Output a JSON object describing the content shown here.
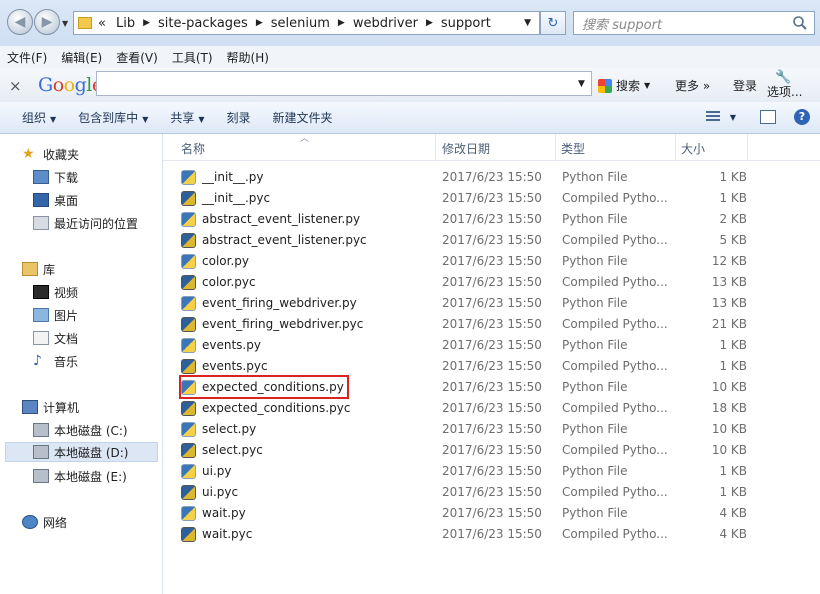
{
  "address": {
    "crumbs": [
      "Lib",
      "site-packages",
      "selenium",
      "webdriver",
      "support"
    ],
    "overflow": "«",
    "search_placeholder": "搜索 support"
  },
  "menu": [
    "文件(F)",
    "编辑(E)",
    "查看(V)",
    "工具(T)",
    "帮助(H)"
  ],
  "google_toolbar": {
    "close": "×",
    "logo": [
      "G",
      "o",
      "o",
      "g",
      "l",
      "e"
    ],
    "logo_colors": [
      "#3a6fd8",
      "#d93c2e",
      "#f0b400",
      "#3a6fd8",
      "#2f9e44",
      "#d93c2e"
    ],
    "search_label": "搜索",
    "more_label": "更多 »",
    "login_label": "登录",
    "options_label": "选项..."
  },
  "commands": [
    "组织",
    "包含到库中",
    "共享",
    "刻录",
    "新建文件夹"
  ],
  "nav": {
    "favorites": "收藏夹",
    "fav_items": [
      "下载",
      "桌面",
      "最近访问的位置"
    ],
    "library": "库",
    "lib_items": [
      "视频",
      "图片",
      "文档",
      "音乐"
    ],
    "computer": "计算机",
    "drives": [
      "本地磁盘 (C:)",
      "本地磁盘 (D:)",
      "本地磁盘 (E:)"
    ],
    "network": "网络"
  },
  "columns": {
    "name": "名称",
    "date": "修改日期",
    "type": "类型",
    "size": "大小"
  },
  "files": [
    {
      "name": "__init__.py",
      "date": "2017/6/23 15:50",
      "type": "Python File",
      "size": "1 KB",
      "kind": "py"
    },
    {
      "name": "__init__.pyc",
      "date": "2017/6/23 15:50",
      "type": "Compiled Pytho...",
      "size": "1 KB",
      "kind": "pyc"
    },
    {
      "name": "abstract_event_listener.py",
      "date": "2017/6/23 15:50",
      "type": "Python File",
      "size": "2 KB",
      "kind": "py"
    },
    {
      "name": "abstract_event_listener.pyc",
      "date": "2017/6/23 15:50",
      "type": "Compiled Pytho...",
      "size": "5 KB",
      "kind": "pyc"
    },
    {
      "name": "color.py",
      "date": "2017/6/23 15:50",
      "type": "Python File",
      "size": "12 KB",
      "kind": "py"
    },
    {
      "name": "color.pyc",
      "date": "2017/6/23 15:50",
      "type": "Compiled Pytho...",
      "size": "13 KB",
      "kind": "pyc"
    },
    {
      "name": "event_firing_webdriver.py",
      "date": "2017/6/23 15:50",
      "type": "Python File",
      "size": "13 KB",
      "kind": "py"
    },
    {
      "name": "event_firing_webdriver.pyc",
      "date": "2017/6/23 15:50",
      "type": "Compiled Pytho...",
      "size": "21 KB",
      "kind": "pyc"
    },
    {
      "name": "events.py",
      "date": "2017/6/23 15:50",
      "type": "Python File",
      "size": "1 KB",
      "kind": "py"
    },
    {
      "name": "events.pyc",
      "date": "2017/6/23 15:50",
      "type": "Compiled Pytho...",
      "size": "1 KB",
      "kind": "pyc"
    },
    {
      "name": "expected_conditions.py",
      "date": "2017/6/23 15:50",
      "type": "Python File",
      "size": "10 KB",
      "kind": "py"
    },
    {
      "name": "expected_conditions.pyc",
      "date": "2017/6/23 15:50",
      "type": "Compiled Pytho...",
      "size": "18 KB",
      "kind": "pyc"
    },
    {
      "name": "select.py",
      "date": "2017/6/23 15:50",
      "type": "Python File",
      "size": "10 KB",
      "kind": "py"
    },
    {
      "name": "select.pyc",
      "date": "2017/6/23 15:50",
      "type": "Compiled Pytho...",
      "size": "10 KB",
      "kind": "pyc"
    },
    {
      "name": "ui.py",
      "date": "2017/6/23 15:50",
      "type": "Python File",
      "size": "1 KB",
      "kind": "py"
    },
    {
      "name": "ui.pyc",
      "date": "2017/6/23 15:50",
      "type": "Compiled Pytho...",
      "size": "1 KB",
      "kind": "pyc"
    },
    {
      "name": "wait.py",
      "date": "2017/6/23 15:50",
      "type": "Python File",
      "size": "4 KB",
      "kind": "py"
    },
    {
      "name": "wait.pyc",
      "date": "2017/6/23 15:50",
      "type": "Compiled Pytho...",
      "size": "4 KB",
      "kind": "pyc"
    }
  ],
  "highlighted_file": "expected_conditions.py",
  "highlight_color": "#d9241f"
}
